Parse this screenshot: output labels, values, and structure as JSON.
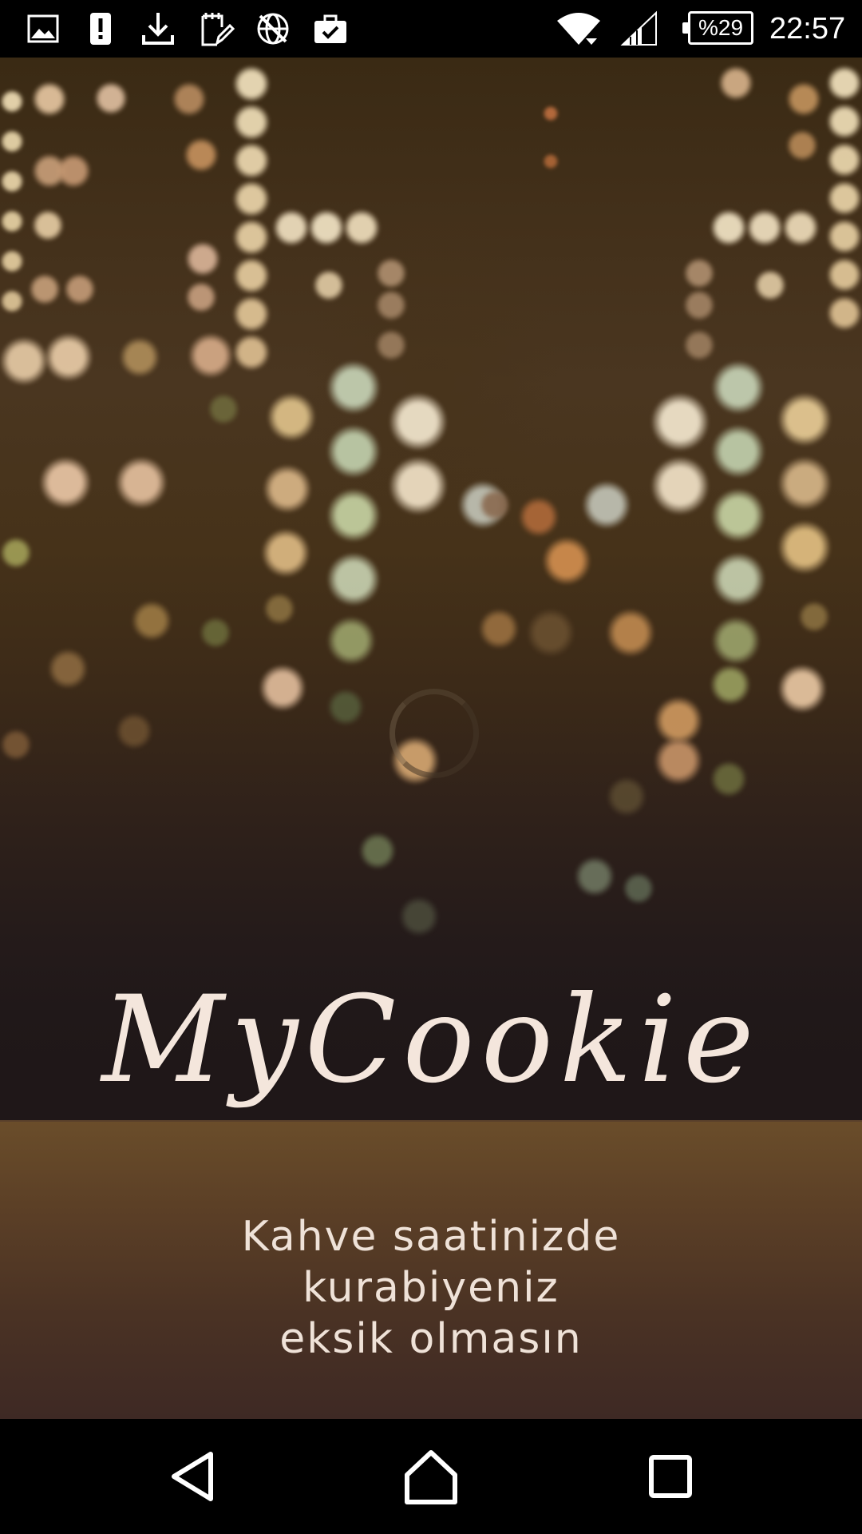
{
  "status_bar": {
    "battery_text": "%29",
    "time": "22:57",
    "icons": [
      "image-icon",
      "alert-icon",
      "download-icon",
      "edit-note-icon",
      "vpn-globe-icon",
      "briefcase-icon",
      "wifi-icon",
      "signal-icon",
      "battery-icon"
    ]
  },
  "splash": {
    "app_name": "MyCookie",
    "slogan_lines": [
      "Kahve saatinizde",
      "kurabiyeniz",
      "eksik olmasın"
    ],
    "loading": true
  },
  "nav_bar": {
    "icons": [
      "back-icon",
      "home-icon",
      "recents-icon"
    ]
  },
  "colors": {
    "title_text": "#f4e6dc",
    "slogan_text": "#efe2d8",
    "panel_top": "#6a4d2a",
    "panel_bottom": "#3e2924",
    "background_dark": "#1f1718"
  }
}
